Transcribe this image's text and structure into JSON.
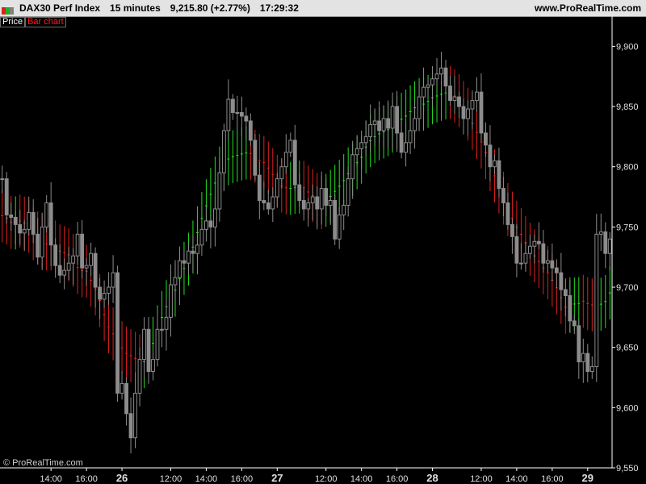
{
  "header": {
    "instrument": "DAX30 Perf Index",
    "interval": "15 minutes",
    "last": "9,215.80 (+2.77%)",
    "time": "17:29:32",
    "brand": "www.ProRealTime.com"
  },
  "window_icons": [
    {
      "name": "window-red-icon",
      "color": "#e02020"
    },
    {
      "name": "window-green-icon",
      "color": "#20b020"
    },
    {
      "name": "window-gray-icon",
      "color": "#808080"
    }
  ],
  "tags": {
    "price": "Price",
    "chart": "Bar chart"
  },
  "copyright": "© ProRealTime.com",
  "colors": {
    "background": "#000000",
    "candle": "#8c8c8c",
    "band_up": "#22e022",
    "band_down": "#e02020",
    "axis": "#ffffff",
    "axis_text": "#e0e0e0"
  },
  "chart_data": {
    "type": "candlestick",
    "y_axis": {
      "ticks": [
        9550,
        9600,
        9650,
        9700,
        9750,
        9800,
        9850,
        9900
      ],
      "tick_labels": [
        "9,550",
        "9,600",
        "9,650",
        "9,700",
        "9,750",
        "9,800",
        "9,850",
        "9,900"
      ],
      "ylim": [
        9550,
        9915
      ]
    },
    "x_axis": {
      "labels": [
        {
          "text": "14:00",
          "bar": 11,
          "bold": false
        },
        {
          "text": "16:00",
          "bar": 19,
          "bold": false
        },
        {
          "text": "26",
          "bar": 27,
          "bold": true
        },
        {
          "text": "12:00",
          "bar": 38,
          "bold": false
        },
        {
          "text": "14:00",
          "bar": 46,
          "bold": false
        },
        {
          "text": "16:00",
          "bar": 54,
          "bold": false
        },
        {
          "text": "27",
          "bar": 62,
          "bold": true
        },
        {
          "text": "12:00",
          "bar": 73,
          "bold": false
        },
        {
          "text": "14:00",
          "bar": 81,
          "bold": false
        },
        {
          "text": "16:00",
          "bar": 89,
          "bold": false
        },
        {
          "text": "28",
          "bar": 97,
          "bold": true
        },
        {
          "text": "12:00",
          "bar": 108,
          "bold": false
        },
        {
          "text": "14:00",
          "bar": 116,
          "bold": false
        },
        {
          "text": "16:00",
          "bar": 124,
          "bold": false
        },
        {
          "text": "29",
          "bar": 132,
          "bold": true
        }
      ]
    },
    "x_range": [
      -0.5,
      137.5
    ],
    "candles_close": [
      9790,
      9760,
      9758,
      9752,
      9745,
      9748,
      9762,
      9744,
      9725,
      9750,
      9770,
      9735,
      9718,
      9710,
      9714,
      9720,
      9726,
      9744,
      9716,
      9718,
      9728,
      9700,
      9690,
      9695,
      9700,
      9712,
      9612,
      9620,
      9595,
      9575,
      9612,
      9640,
      9665,
      9630,
      9640,
      9665,
      9665,
      9675,
      9702,
      9708,
      9722,
      9720,
      9730,
      9728,
      9735,
      9748,
      9755,
      9750,
      9765,
      9795,
      9830,
      9856,
      9845,
      9845,
      9842,
      9838,
      9822,
      9793,
      9772,
      9770,
      9765,
      9775,
      9790,
      9800,
      9812,
      9822,
      9785,
      9772,
      9765,
      9770,
      9775,
      9765,
      9782,
      9768,
      9772,
      9740,
      9760,
      9768,
      9790,
      9810,
      9815,
      9820,
      9825,
      9835,
      9838,
      9830,
      9840,
      9832,
      9850,
      9828,
      9812,
      9820,
      9830,
      9840,
      9858,
      9866,
      9868,
      9873,
      9877,
      9882,
      9867,
      9855,
      9858,
      9850,
      9840,
      9848,
      9855,
      9862,
      9828,
      9818,
      9800,
      9805,
      9782,
      9770,
      9752,
      9742,
      9720,
      9720,
      9728,
      9734,
      9738,
      9736,
      9720,
      9722,
      9716,
      9712,
      9698,
      9693,
      9672,
      9668,
      9638,
      9645,
      9630,
      9634,
      9744,
      9746,
      9728,
      9740
    ]
  }
}
